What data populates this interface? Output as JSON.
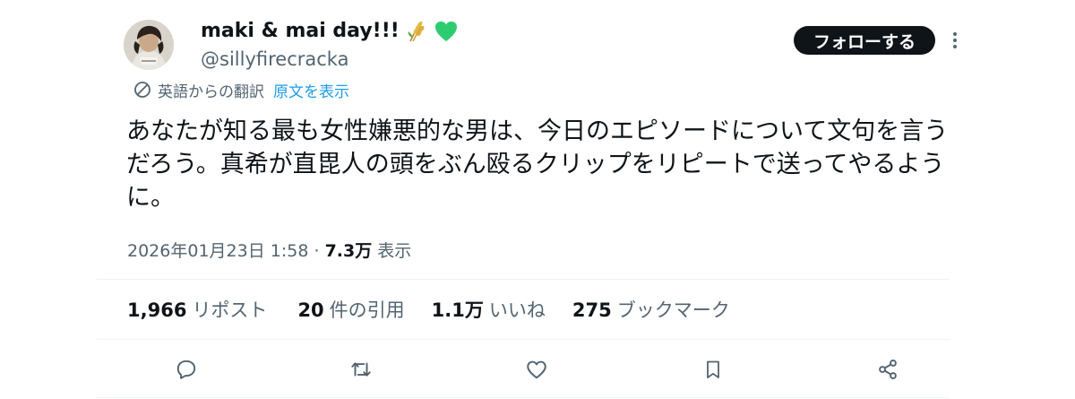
{
  "author": {
    "display_name": "maki & mai day!!!",
    "handle": "@sillyfirecracka",
    "name_emojis": [
      "rice-sheaf-emoji",
      "green-heart-emoji"
    ]
  },
  "follow_button": {
    "label": "フォローする"
  },
  "translation": {
    "label": "英語からの翻訳",
    "show_original": "原文を表示"
  },
  "tweet": {
    "text": "あなたが知る最も女性嫌悪的な男は、今日のエピソードについて文句を言うだろう。真希が直毘人の頭をぶん殴るクリップをリピートで送ってやるように。"
  },
  "meta": {
    "timestamp": "2026年01月23日 1:58",
    "separator": "·",
    "views_count": "7.3万",
    "views_label": "表示"
  },
  "stats": {
    "retweets": {
      "count": "1,966",
      "label": "リポスト"
    },
    "quotes": {
      "count": "20",
      "label": "件の引用"
    },
    "likes": {
      "count": "1.1万",
      "label": "いいね"
    },
    "bookmarks": {
      "count": "275",
      "label": "ブックマーク"
    }
  },
  "actions": [
    "reply-icon",
    "retweet-icon",
    "like-icon",
    "bookmark-icon",
    "share-icon"
  ],
  "colors": {
    "text_primary": "#0f1419",
    "text_secondary": "#536471",
    "link": "#1d9bf0",
    "follow_button_bg": "#0f1419",
    "divider": "#eff3f4"
  }
}
